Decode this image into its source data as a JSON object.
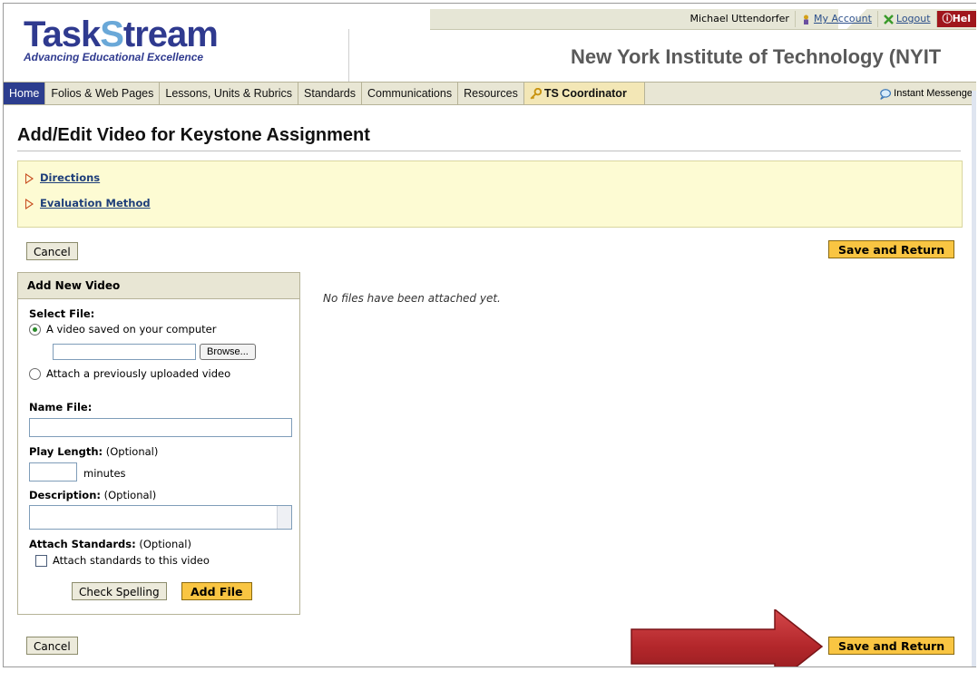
{
  "header": {
    "user_name": "Michael Uttendorfer",
    "my_account": "My Account",
    "logout": "Logout",
    "help": "Hel",
    "logo_task": "Task",
    "logo_s": "S",
    "logo_tream": "tream",
    "logo_tagline": "Advancing Educational Excellence",
    "institution": "New York Institute of Technology (NYIT"
  },
  "nav": {
    "tabs": [
      "Home",
      "Folios & Web Pages",
      "Lessons, Units & Rubrics",
      "Standards",
      "Communications",
      "Resources"
    ],
    "coordinator": "TS Coordinator",
    "instant_messenger": "Instant Messenge"
  },
  "page": {
    "title": "Add/Edit Video for Keystone Assignment",
    "directions": "Directions",
    "evaluation": "Evaluation Method",
    "cancel": "Cancel",
    "save_return": "Save and Return",
    "no_files": "No files have been attached yet."
  },
  "panel": {
    "title": "Add New Video",
    "select_file": "Select File:",
    "opt_computer": "A video saved on your computer",
    "browse": "Browse...",
    "opt_previous": "Attach a previously uploaded video",
    "name_file": "Name File:",
    "play_length": "Play Length:",
    "optional": "(Optional)",
    "minutes": "minutes",
    "description": "Description:",
    "attach_standards": "Attach Standards:",
    "attach_checkbox": "Attach standards to this video",
    "check_spelling": "Check Spelling",
    "add_file": "Add File"
  },
  "colors": {
    "nav_active": "#2c3d8e",
    "gold_button": "#f9c542",
    "arrow": "#b3272b"
  }
}
